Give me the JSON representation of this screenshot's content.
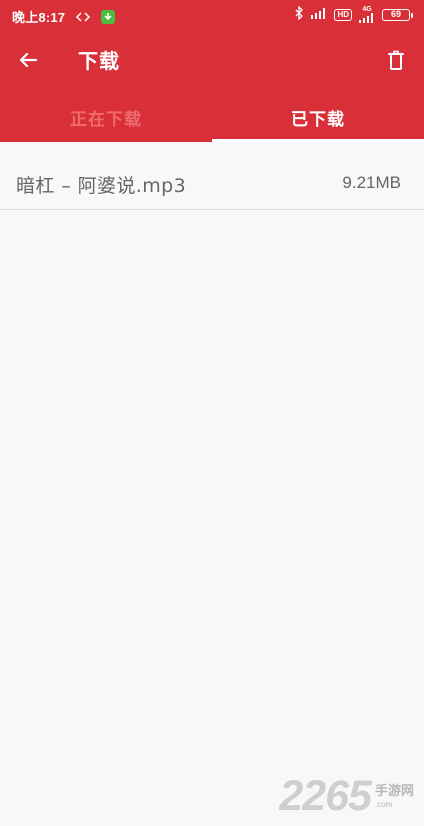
{
  "colors": {
    "header_red": "#D82F38",
    "tab_inactive": "#EE6A6E",
    "text_gray": "#666666",
    "background": "#F8F8F8"
  },
  "status_bar": {
    "time": "晚上8:17",
    "signal_label": "4G",
    "hd_label": "HD",
    "battery": "69"
  },
  "toolbar": {
    "title": "下载",
    "back_icon": "arrow-left-icon",
    "delete_icon": "trash-icon"
  },
  "tabs": [
    {
      "label": "正在下载",
      "active": false
    },
    {
      "label": "已下载",
      "active": true
    }
  ],
  "downloads": [
    {
      "name": "暗杠  – 阿婆说.mp3",
      "size": "9.21MB"
    }
  ],
  "watermark": {
    "number": "2265",
    "cn": "手游网",
    "en": ".com"
  }
}
